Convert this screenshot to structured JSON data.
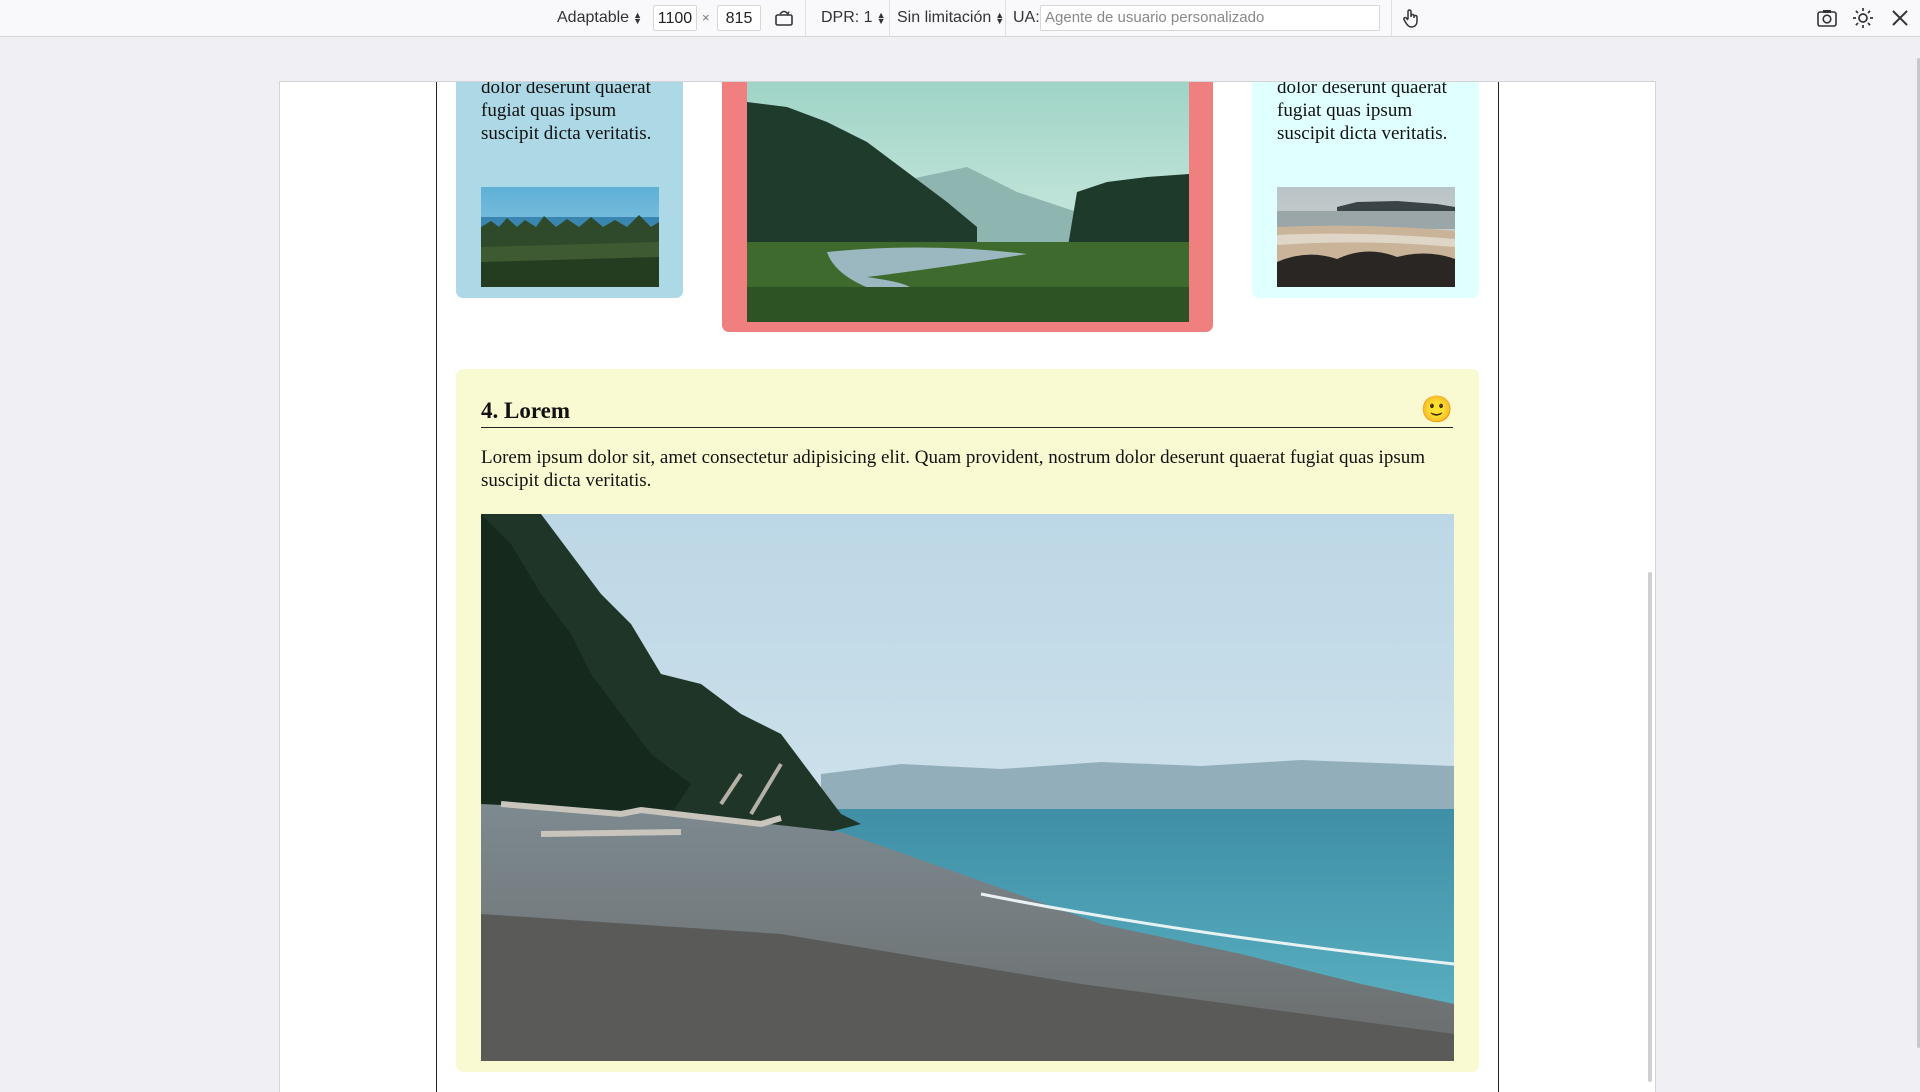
{
  "toolbar": {
    "device_label": "Adaptable",
    "width_value": "1100",
    "times_sign": "×",
    "height_value": "815",
    "dpr_label": "DPR: 1",
    "throttle_label": "Sin limitación",
    "ua_label": "UA:",
    "ua_placeholder": "Agente de usuario personalizado",
    "icons": [
      "rotate-icon",
      "touch-icon",
      "screenshot-icon",
      "settings-icon",
      "close-icon"
    ]
  },
  "page": {
    "card_blue_text": "dolor deserunt quaerat fugiat quas ipsum suscipit dicta veritatis.",
    "card_cyan_text": "dolor deserunt quaerat fugiat quas ipsum suscipit dicta veritatis.",
    "section_title": "4. Lorem",
    "section_emoji": "🙂",
    "section_text": "Lorem ipsum dolor sit, amet consectetur adipisicing elit. Quam provident, nostrum dolor deserunt quaerat fugiat quas ipsum suscipit dicta veritatis."
  },
  "colors": {
    "card_blue": "#add8e6",
    "card_red": "#f08080",
    "card_cyan": "#e0ffff",
    "card_yellow": "#fafad2"
  }
}
